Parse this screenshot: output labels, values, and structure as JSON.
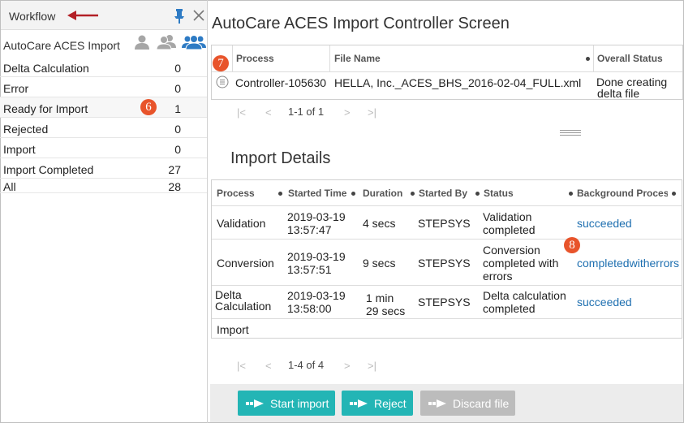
{
  "workflow": {
    "title": "Workflow",
    "subheader": "AutoCare ACES Import",
    "items": [
      {
        "label": "Delta Calculation",
        "count": "0"
      },
      {
        "label": "Error",
        "count": "0"
      },
      {
        "label": "Ready for Import",
        "count": "1"
      },
      {
        "label": "Rejected",
        "count": "0"
      },
      {
        "label": "Import",
        "count": "0"
      },
      {
        "label": "Import Completed",
        "count": "27"
      },
      {
        "label": "All",
        "count": "28"
      }
    ]
  },
  "callouts": {
    "c6": "6",
    "c7": "7",
    "c8": "8"
  },
  "main": {
    "title": "AutoCare ACES Import Controller Screen",
    "process_table": {
      "headers": {
        "process": "Process",
        "file_name": "File Name",
        "status": "Overall Status"
      },
      "rows": [
        {
          "process": "Controller-105630",
          "file_name": "HELLA, Inc._ACES_BHS_2016-02-04_FULL.xml",
          "status_line1": "Done creating",
          "status_line2": "delta file"
        }
      ],
      "pager": "1-1 of 1"
    },
    "details": {
      "title": "Import Details",
      "headers": {
        "process": "Process",
        "started_time": "Started Time",
        "duration": "Duration",
        "started_by": "Started By",
        "status": "Status",
        "background": "Background Proces"
      },
      "rows": [
        {
          "process": "Validation",
          "time1": "2019-03-19",
          "time2": "13:57:47",
          "duration1": "4 secs",
          "duration2": "",
          "by": "STEPSYS",
          "status1": "Validation",
          "status2": "completed",
          "status3": "",
          "bg": "succeeded"
        },
        {
          "process": "Conversion",
          "time1": "2019-03-19",
          "time2": "13:57:51",
          "duration1": "9 secs",
          "duration2": "",
          "by": "STEPSYS",
          "status1": "Conversion",
          "status2": "completed with",
          "status3": "errors",
          "bg": "completedwitherrors"
        },
        {
          "process1": "Delta",
          "process2": "Calculation",
          "time1": "2019-03-19",
          "time2": "13:58:00",
          "duration1": "1 min",
          "duration2": "29 secs",
          "by": "STEPSYS",
          "status1": "Delta calculation",
          "status2": "completed",
          "status3": "",
          "bg": "succeeded"
        },
        {
          "process": "Import"
        }
      ],
      "pager": "1-4 of 4"
    },
    "actions": {
      "start_import": "Start import",
      "reject": "Reject",
      "discard": "Discard file"
    }
  },
  "colors": {
    "accent": "#23b5b5",
    "link": "#1e6fb0",
    "callout": "#e8542b",
    "pin": "#2e7bc4",
    "arrow": "#b32026"
  }
}
